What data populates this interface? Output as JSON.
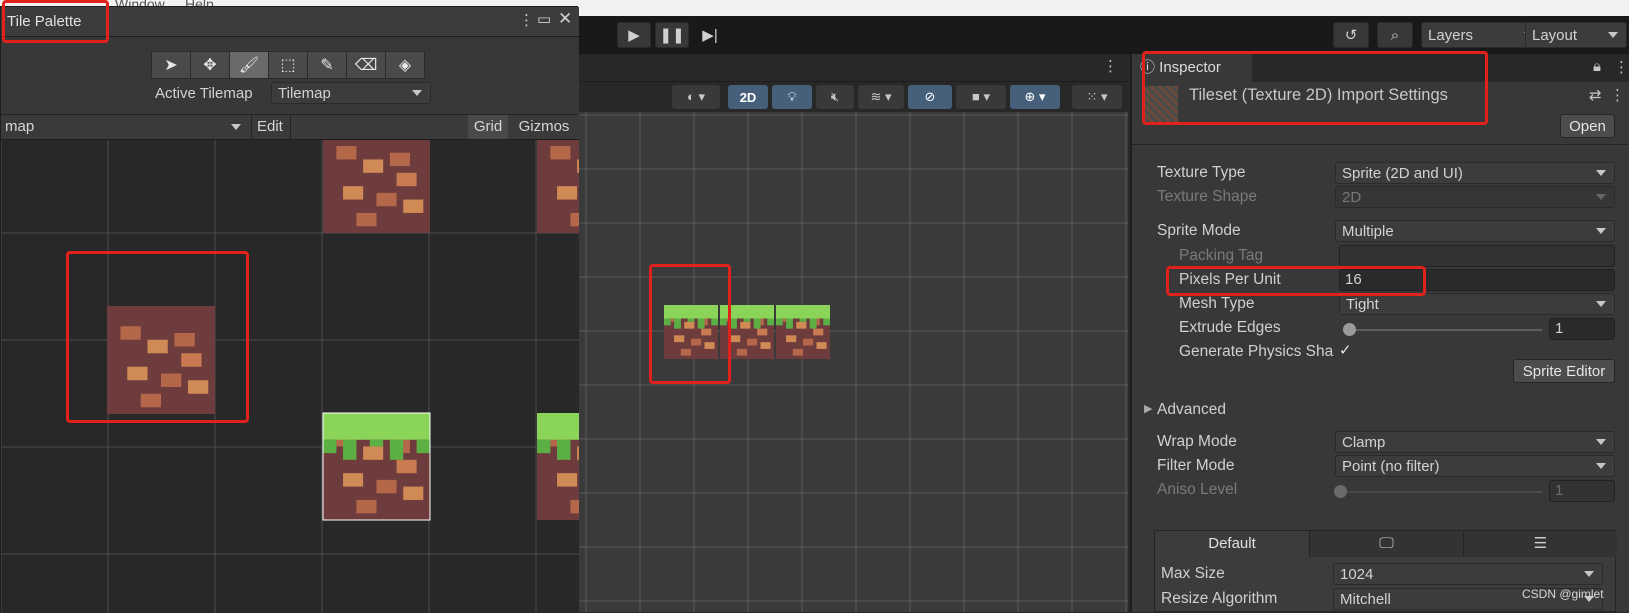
{
  "menu": {
    "items": [
      "Window",
      "Help"
    ]
  },
  "toolbar": {
    "layers": "Layers",
    "layout": "Layout"
  },
  "palette": {
    "title": "Tile Palette",
    "active_tilemap_label": "Active Tilemap",
    "active_tilemap_value": "Tilemap",
    "palette_select": "map",
    "edit": "Edit",
    "grid": "Grid",
    "gizmos": "Gizmos",
    "tools": [
      "select-tool",
      "move-tool",
      "paint-tool",
      "box-fill-tool",
      "picker-tool",
      "eraser-tool",
      "fill-tool"
    ],
    "active_tool": "paint-tool"
  },
  "scene": {
    "btn_2d": "2D"
  },
  "inspector": {
    "tab": "Inspector",
    "header": "Tileset (Texture 2D) Import Settings",
    "open": "Open",
    "texture_type": {
      "label": "Texture Type",
      "value": "Sprite (2D and UI)"
    },
    "texture_shape": {
      "label": "Texture Shape",
      "value": "2D"
    },
    "sprite_mode": {
      "label": "Sprite Mode",
      "value": "Multiple"
    },
    "packing_tag": {
      "label": "Packing Tag",
      "value": ""
    },
    "pixels_per_unit": {
      "label": "Pixels Per Unit",
      "value": "16"
    },
    "mesh_type": {
      "label": "Mesh Type",
      "value": "Tight"
    },
    "extrude_edges": {
      "label": "Extrude Edges",
      "value": "1",
      "fraction": 0.0
    },
    "generate_physics": {
      "label": "Generate Physics Sha",
      "checked": "✓"
    },
    "sprite_editor": "Sprite Editor",
    "advanced": "Advanced",
    "wrap_mode": {
      "label": "Wrap Mode",
      "value": "Clamp"
    },
    "filter_mode": {
      "label": "Filter Mode",
      "value": "Point (no filter)"
    },
    "aniso_level": {
      "label": "Aniso Level",
      "value": "1",
      "fraction": 0.0
    },
    "platform_tab": "Default",
    "max_size": {
      "label": "Max Size",
      "value": "1024"
    },
    "resize_algorithm": {
      "label": "Resize Algorithm",
      "value": "Mitchell"
    }
  },
  "watermark": "CSDN @gimlet",
  "colors": {
    "highlight_red": "#e0211c",
    "grass": "#8ad45a",
    "dirt": "#b5674a"
  }
}
